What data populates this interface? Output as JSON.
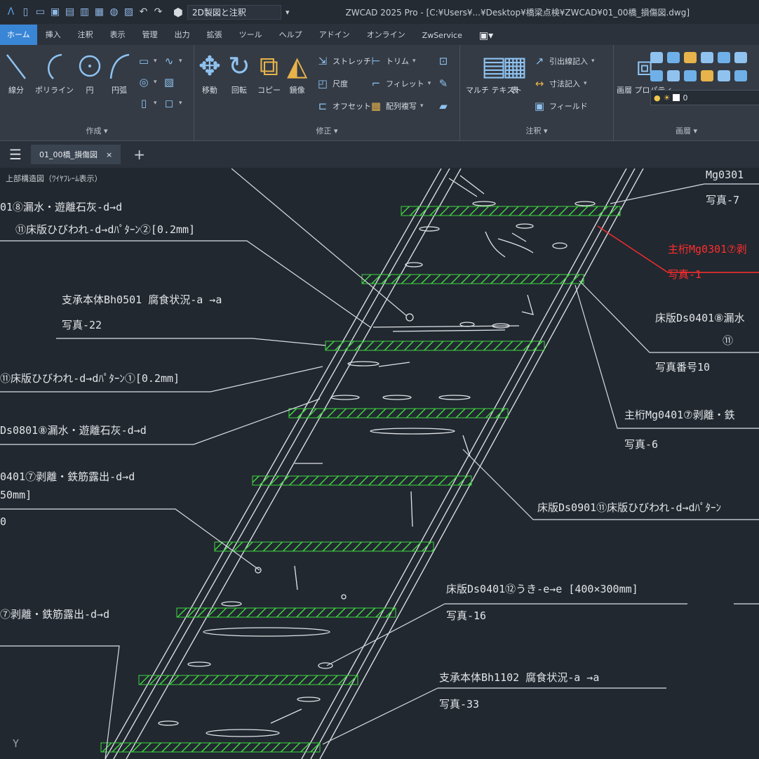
{
  "titlebar": {
    "workspace": "2D製図と注釈",
    "title": "ZWCAD 2025 Pro - [C:¥Users¥...¥Desktop¥橋梁点検¥ZWCAD¥01_00橋_損傷図.dwg]"
  },
  "ribbon_tabs": [
    "ホーム",
    "挿入",
    "注釈",
    "表示",
    "管理",
    "出力",
    "拡張",
    "ツール",
    "ヘルプ",
    "アドイン",
    "オンライン",
    "ZwService",
    "▣▾"
  ],
  "active_tab_index": 0,
  "panels": {
    "draw": {
      "title": "作成 ▾",
      "large_buttons": [
        "線分",
        "ポリライン",
        "円",
        "円弧"
      ]
    },
    "modify": {
      "title": "修正 ▾",
      "large_buttons": [
        "移動",
        "回転",
        "コピー",
        "鏡像"
      ],
      "small_buttons": [
        "ストレッチ",
        "尺度",
        "オフセット",
        "トリム",
        "フィレット",
        "配列複写"
      ]
    },
    "annotation": {
      "title": "注釈 ▾",
      "large_buttons": [
        "マルチ テキスト",
        "表"
      ],
      "small_buttons": [
        "引出線記入",
        "寸法記入",
        "フィールド"
      ]
    },
    "layers": {
      "title": "画層 ▾",
      "large_buttons": [
        "画層 プロパティ"
      ],
      "current_layer": "0"
    }
  },
  "doc_tab": {
    "name": "01_00橋_損傷図"
  },
  "drawing": {
    "annotations": [
      "上部構造図（ﾜｲﾔﾌﾚｰﾑ表示）",
      "01⑧漏水・遊離石灰-d→d",
      "⑪床版ひびわれ-d→dﾊﾟﾀｰﾝ②[0.2mm]",
      "支承本体Bh0501 腐食状況-a →a",
      "写真-22",
      "⑪床版ひびわれ-d→dﾊﾟﾀｰﾝ①[0.2mm]",
      "Ds0801⑧漏水・遊離石灰-d→d",
      "0401⑦剥離・鉄筋露出-d→d",
      "50mm]",
      "0",
      "⑦剥離・鉄筋露出-d→d",
      "床版Ds0401⑫うき-e→e [400×300mm]",
      "写真-16",
      "支承本体Bh1102 腐食状況-a →a",
      "写真-33",
      "Mg0301",
      "写真-7",
      "主桁Mg0301⑦剥",
      "写真-1",
      "床版Ds0401⑧漏水",
      "⑪",
      "写真番号10",
      "主桁Mg0401⑦剥離・鉄",
      "写真-6",
      "床版Ds0901⑪床版ひびわれ-d→dﾊﾟﾀｰﾝ",
      "Y"
    ]
  },
  "colors": {
    "canvas": "#212830",
    "ribbon": "#343b45",
    "accent": "#3a86d6",
    "hatch": "#3fd33f",
    "red_text": "#ff2d2d"
  }
}
